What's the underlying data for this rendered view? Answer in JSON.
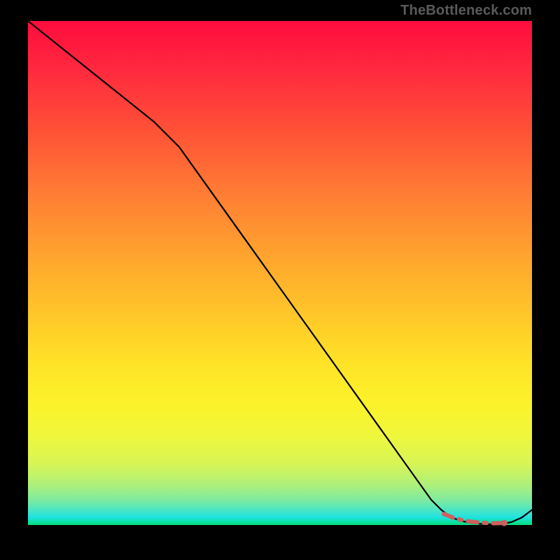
{
  "watermark": "TheBottleneck.com",
  "colors": {
    "page_bg": "#000000",
    "curve": "#000000",
    "dash_stroke": "#cc6060",
    "dash_fill": "#cc6060",
    "gradient_top": "#ff0c3e",
    "gradient_bottom": "#00e07a"
  },
  "chart_data": {
    "type": "line",
    "title": "",
    "xlabel": "",
    "ylabel": "",
    "xlim": [
      0,
      100
    ],
    "ylim": [
      0,
      100
    ],
    "series": [
      {
        "name": "bottleneck-curve",
        "x": [
          0,
          5,
          10,
          15,
          20,
          25,
          30,
          35,
          40,
          45,
          50,
          55,
          60,
          65,
          70,
          75,
          80,
          82,
          84,
          86,
          88,
          90,
          92,
          94,
          96,
          98,
          100
        ],
        "y": [
          100,
          96,
          92,
          88,
          84,
          80,
          75,
          68,
          61,
          54,
          47,
          40,
          33,
          26,
          19,
          12,
          5,
          3,
          1.5,
          0.8,
          0.4,
          0.2,
          0.15,
          0.2,
          0.6,
          1.5,
          3
        ]
      }
    ],
    "markers": {
      "name": "optimal-range-dots",
      "x": [
        82.5,
        84.5,
        86,
        87.5,
        89.5,
        91,
        92.5,
        94.5
      ],
      "y": [
        2.2,
        1.4,
        1.0,
        0.7,
        0.5,
        0.4,
        0.35,
        0.4
      ]
    }
  }
}
